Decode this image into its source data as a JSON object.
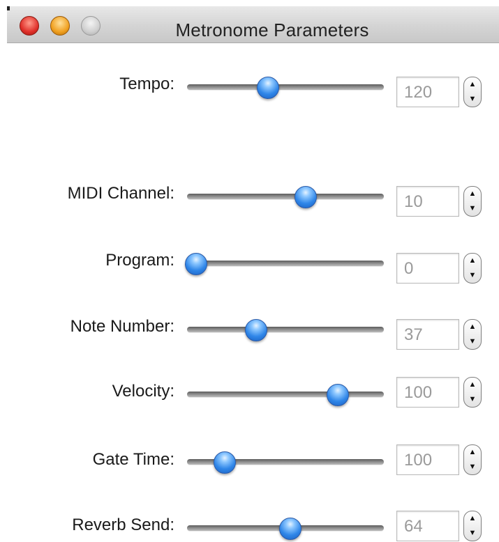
{
  "window": {
    "title": "Metronome Parameters"
  },
  "params": [
    {
      "label": "Tempo:",
      "value": "120",
      "level": 0.38
    },
    {
      "label": "MIDI Channel:",
      "value": "10",
      "level": 0.58
    },
    {
      "label": "Program:",
      "value": "0",
      "level": 0.0
    },
    {
      "label": "Note Number:",
      "value": "37",
      "level": 0.32
    },
    {
      "label": "Velocity:",
      "value": "100",
      "level": 0.75
    },
    {
      "label": "Gate Time:",
      "value": "100",
      "level": 0.15
    },
    {
      "label": "Reverb Send:",
      "value": "64",
      "level": 0.5
    }
  ],
  "icons": {
    "close": "close-icon",
    "minimize": "minimize-icon",
    "zoom": "zoom-icon",
    "stepper_up": "▲",
    "stepper_down": "▼"
  },
  "colors": {
    "knob": "#2f86e8",
    "close": "#e0302a",
    "minimize": "#f0a020",
    "zoom": "#cfcfcf"
  }
}
